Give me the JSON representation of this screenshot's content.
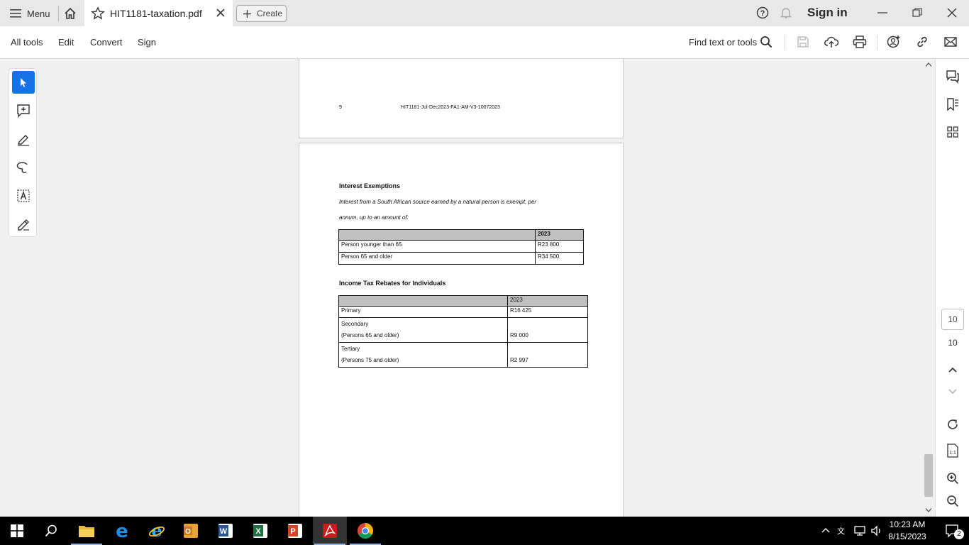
{
  "window": {
    "menu_label": "Menu",
    "tab_title": "HIT1181-taxation.pdf",
    "create_label": "Create",
    "sign_in": "Sign in"
  },
  "toolbar": {
    "items": [
      "All tools",
      "Edit",
      "Convert",
      "Sign"
    ],
    "find_text": "Find text or tools"
  },
  "document": {
    "prev_page": {
      "page_number": "9",
      "footer_code": "HIT1181-Jul-Dec2023-FA1-AM-V3-10072023"
    },
    "interest": {
      "heading": "Interest Exemptions",
      "line1": "Interest from a South African source earned by a natural person is exempt, per",
      "line2": "annum, up to an amount of:",
      "year": "2023",
      "rows": [
        {
          "label": "Person younger than 65",
          "value": "R23 800"
        },
        {
          "label": "Person 65 and older",
          "value": "R34 500"
        }
      ]
    },
    "rebates": {
      "heading": "Income Tax Rebates for Individuals",
      "year": "2023",
      "rows": [
        {
          "label1": "Primary",
          "label2": "",
          "value": "R16 425"
        },
        {
          "label1": "Secondary",
          "label2": "(Persons 65 and older)",
          "value": "R9 000"
        },
        {
          "label1": "Tertiary",
          "label2": "(Persons 75 and older)",
          "value": "R2 997"
        }
      ]
    }
  },
  "navigation": {
    "current_page": "10",
    "total_pages": "10"
  },
  "taskbar": {
    "time": "10:23 AM",
    "date": "8/15/2023",
    "notification_count": "2"
  },
  "colors": {
    "accent": "#1473e6",
    "acrobat_red": "#c51d1d",
    "table_header": "#c0c0c0"
  }
}
